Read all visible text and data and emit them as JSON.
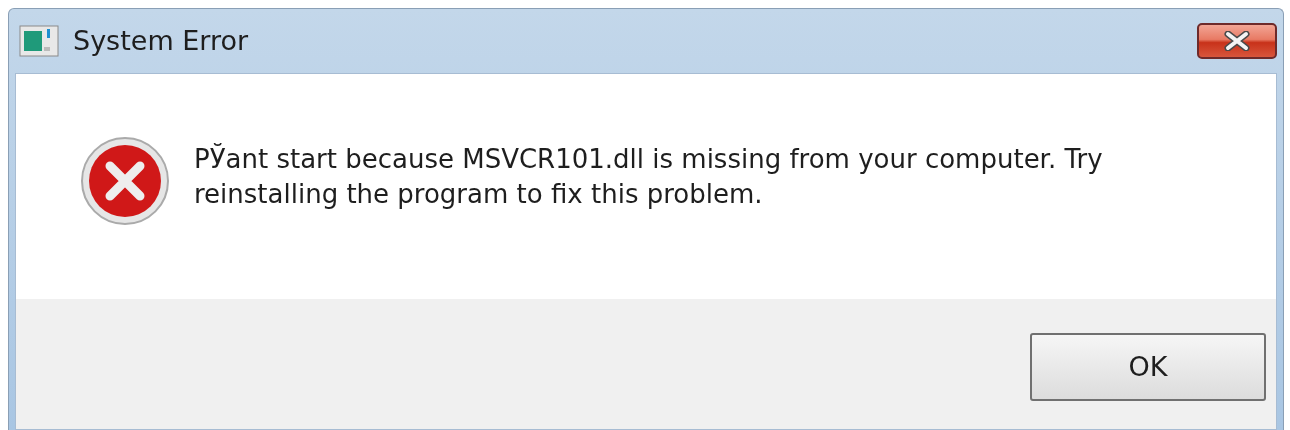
{
  "window": {
    "title": "System Error"
  },
  "message": "РЎant start because MSVCR101.dll is missing from your computer. Try reinstalling the program to fix this problem.",
  "buttons": [
    "OK"
  ]
}
